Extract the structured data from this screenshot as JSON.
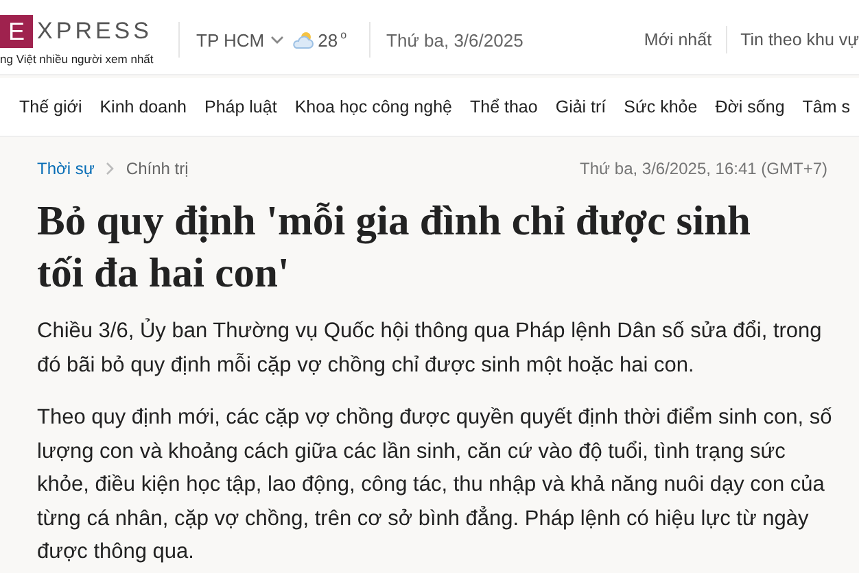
{
  "header": {
    "logo_letter": "E",
    "logo_rest": "XPRESS",
    "tagline": "ng Việt nhiều người xem nhất",
    "location": "TP HCM",
    "temperature": "28",
    "degree": "o",
    "date": "Thứ ba, 3/6/2025",
    "links": [
      "Mới nhất",
      "Tin theo khu vự"
    ]
  },
  "nav": [
    "Thế giới",
    "Kinh doanh",
    "Pháp luật",
    "Khoa học công nghệ",
    "Thể thao",
    "Giải trí",
    "Sức khỏe",
    "Đời sống",
    "Tâm s"
  ],
  "breadcrumb": [
    "Thời sự",
    "Chính trị"
  ],
  "published": "Thứ ba, 3/6/2025, 16:41 (GMT+7)",
  "title": "Bỏ quy định 'mỗi gia đình chỉ được sinh tối đa hai con'",
  "paragraphs": [
    "Chiều 3/6, Ủy ban Thường vụ Quốc hội thông qua Pháp lệnh Dân số sửa đổi, trong đó bãi bỏ quy định mỗi cặp vợ chồng chỉ được sinh một hoặc hai con.",
    "Theo quy định mới, các cặp vợ chồng được quyền quyết định thời điểm sinh con, số lượng con và khoảng cách giữa các lần sinh, căn cứ vào độ tuổi, tình trạng sức khỏe, điều kiện học tập, lao động, công tác, thu nhập và khả năng nuôi dạy con của từng cá nhân, cặp vợ chồng, trên cơ sở bình đẳng. Pháp lệnh có hiệu lực từ ngày được thông qua."
  ]
}
